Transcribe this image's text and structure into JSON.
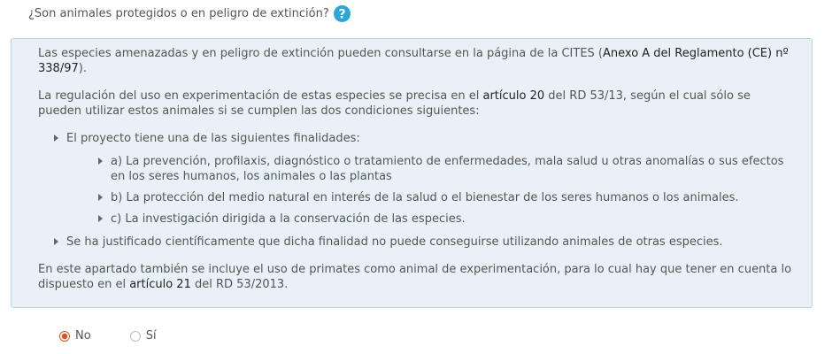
{
  "question": {
    "text": "¿Son animales protegidos o en peligro de extinción?",
    "help_icon": "question-circle-icon",
    "help_color": "#2aa6d8"
  },
  "info": {
    "p1_before": "Las especies amenazadas y en peligro de extinción pueden consultarse en la página de la CITES (",
    "p1_link": "Anexo A del Reglamento (CE) nº 338/97",
    "p1_after": ").",
    "p2_before": "La regulación del uso en experimentación de estas especies se precisa en el ",
    "p2_link": "artículo 20",
    "p2_after": " del RD 53/13, según el cual sólo se pueden utilizar estos animales si se cumplen las dos condiciones siguientes:",
    "bullet1": "El proyecto tiene una de las siguientes finalidades:",
    "sub_bullets": [
      "a) La prevención, profilaxis, diagnóstico o tratamiento de enfermedades, mala salud u otras anomalías o sus efectos en los seres humanos, los animales o las plantas",
      "b) La protección del medio natural en interés de la salud o el bienestar de los seres humanos o los animales.",
      "c) La investigación dirigida a la conservación de las especies."
    ],
    "bullet2": "Se ha justificado científicamente que dicha finalidad no puede conseguirse utilizando animales de otras especies.",
    "p3_before": "En este apartado también se incluye el uso de primates como animal de experimentación, para lo cual hay que tener en cuenta lo dispuesto en el ",
    "p3_link": "artículo 21",
    "p3_after": " del RD 53/2013."
  },
  "options": {
    "no_label": "No",
    "si_label": "Sí",
    "selected": "No"
  }
}
